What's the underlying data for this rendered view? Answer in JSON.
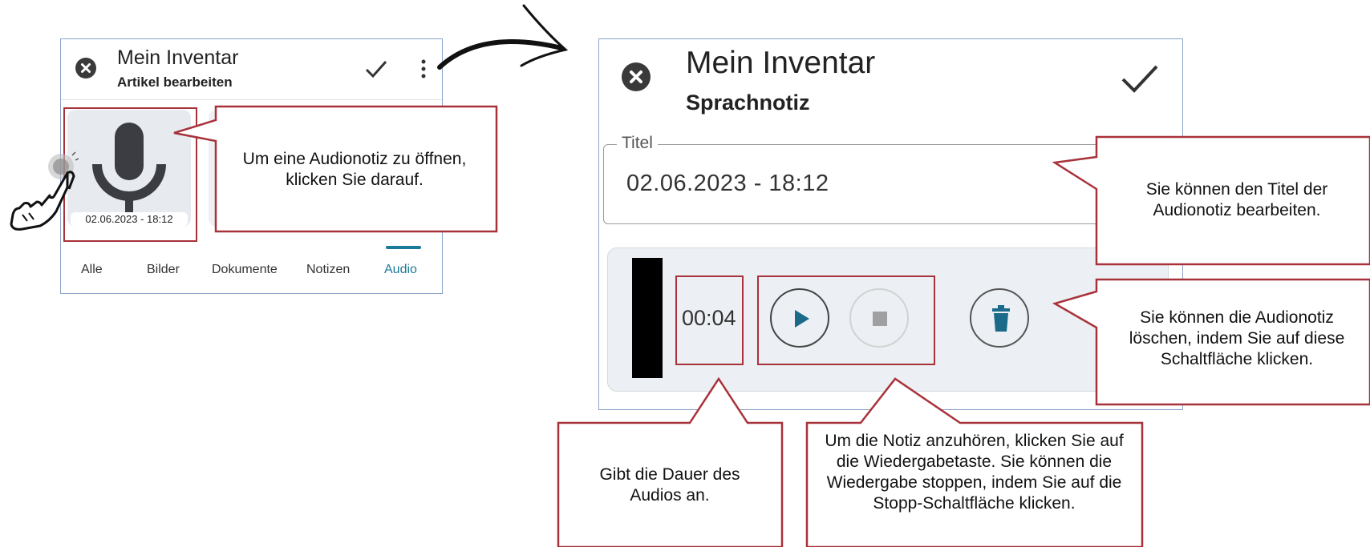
{
  "small_screen": {
    "app_title": "Mein Inventar",
    "subtitle": "Artikel bearbeiten",
    "tile_timestamp": "02.06.2023 - 18:12",
    "tabs": [
      {
        "label": "Alle"
      },
      {
        "label": "Bilder"
      },
      {
        "label": "Dokumente"
      },
      {
        "label": "Notizen"
      },
      {
        "label": "Audio",
        "active": true
      }
    ],
    "accent_color": "#1b7a99"
  },
  "large_screen": {
    "app_title": "Mein Inventar",
    "subtitle": "Sprachnotiz",
    "title_field_label": "Titel",
    "title_field_value": "02.06.2023 - 18:12",
    "duration": "00:04",
    "play_color": "#1b6a8a"
  },
  "callouts": {
    "open_note": "Um eine Audionotiz zu öffnen, klicken Sie darauf.",
    "edit_title": "Sie können den Titel der Audionotiz bearbeiten.",
    "delete_note": "Sie können die Audionotiz löschen, indem Sie auf diese Schaltfläche klicken.",
    "duration_info": "Gibt die Dauer des Audios an.",
    "playback_info": "Um die Notiz anzuhören, klicken Sie auf die Wiedergabetaste. Sie können die Wiedergabe stoppen, indem Sie auf die Stopp-Schaltfläche klicken."
  },
  "callout_border_color": "#a8323a"
}
